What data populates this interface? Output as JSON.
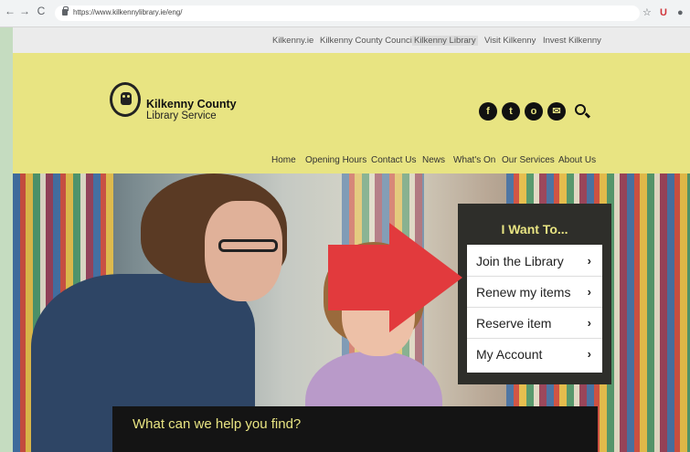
{
  "browser": {
    "back": "←",
    "forward": "→",
    "reload": "C",
    "url": "https://www.kilkennylibrary.ie/eng/"
  },
  "topnav": {
    "links": [
      "Kilkenny.ie",
      "Kilkenny County Council",
      "Kilkenny Library",
      "Visit Kilkenny",
      "Invest Kilkenny"
    ],
    "active_index": 2
  },
  "brand": {
    "line1": "Kilkenny County",
    "line2": "Library Service"
  },
  "social_icons": [
    "facebook-icon",
    "twitter-icon",
    "instagram-icon",
    "email-icon",
    "search-icon"
  ],
  "social_glyphs": [
    "f",
    "t",
    "o",
    "✉"
  ],
  "mainnav": {
    "items": [
      "Home",
      "Opening Hours",
      "Contact Us",
      "News",
      "What's On",
      "Our Services",
      "About Us"
    ]
  },
  "panel": {
    "title": "I Want To...",
    "items": [
      {
        "label": "Join the Library",
        "chevron": "›"
      },
      {
        "label": "Renew my items",
        "chevron": "›"
      },
      {
        "label": "Reserve item",
        "chevron": "›"
      },
      {
        "label": "My Account",
        "chevron": "›"
      }
    ]
  },
  "search_prompt": "What can we help you find?",
  "colors": {
    "header_yellow": "#e8e482",
    "panel_dark": "#2e2e2a",
    "arrow_red": "#e23a3d"
  }
}
